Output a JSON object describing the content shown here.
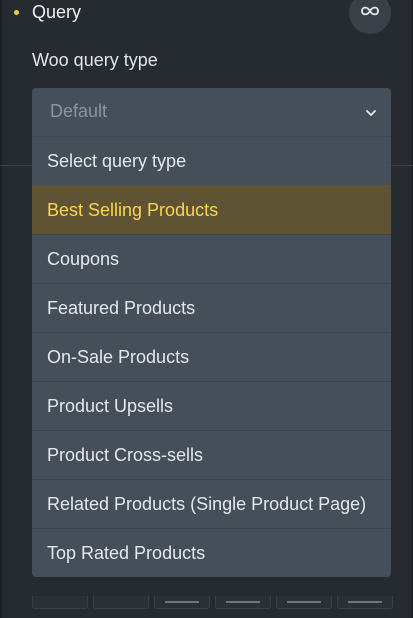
{
  "header": {
    "title": "Query",
    "loop_icon": "infinity-icon",
    "accent_color": "#f4c84a"
  },
  "field": {
    "label": "Woo query type",
    "selected_value": "Default",
    "chevron_icon": "chevron-down-icon"
  },
  "dropdown": {
    "options": [
      {
        "label": "Select query type"
      },
      {
        "label": "Best Selling Products",
        "highlighted": true
      },
      {
        "label": "Coupons"
      },
      {
        "label": "Featured Products"
      },
      {
        "label": "On-Sale Products"
      },
      {
        "label": "Product Upsells"
      },
      {
        "label": "Product Cross-sells"
      },
      {
        "label": "Related Products (Single Product Page)"
      },
      {
        "label": "Top Rated Products"
      }
    ],
    "highlight_color": "#5e5333",
    "highlight_text_color": "#ffd34d"
  }
}
